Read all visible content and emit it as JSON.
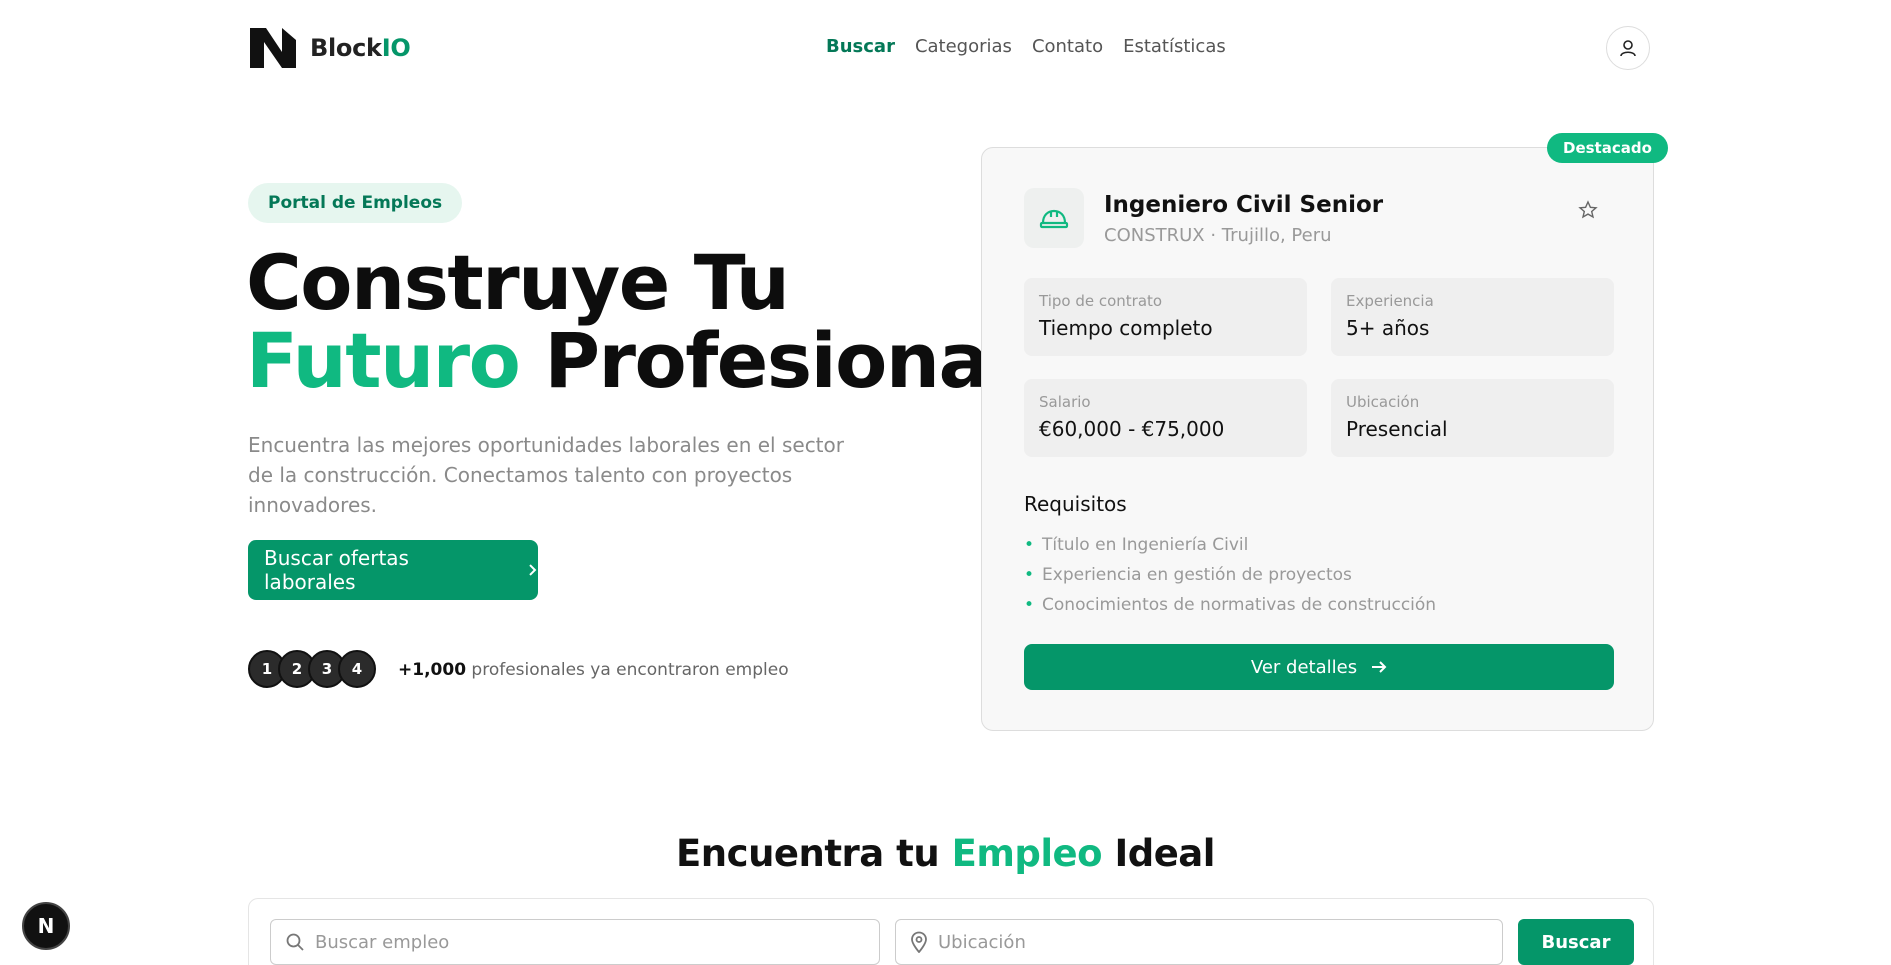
{
  "header": {
    "brand_prefix": "Block",
    "brand_suffix": "IO",
    "nav": [
      {
        "label": "Buscar",
        "active": true
      },
      {
        "label": "Categorias",
        "active": false
      },
      {
        "label": "Contato",
        "active": false
      },
      {
        "label": "Estatísticas",
        "active": false
      }
    ],
    "user_icon": "user-icon"
  },
  "hero": {
    "badge": "Portal de Empleos",
    "title_line1": "Construye Tu",
    "title_green": "Futuro",
    "title_rest": " Profesional",
    "description": "Encuentra las mejores oportunidades laborales en el sector de la construcción. Conectamos talento con proyectos innovadores.",
    "cta_label": "Buscar ofertas laborales",
    "avatars": [
      "1",
      "2",
      "3",
      "4"
    ],
    "pros_count": "+1,000",
    "pros_text": " profesionales ya encontraron empleo"
  },
  "job_card": {
    "featured_badge": "Destacado",
    "title": "Ingeniero Civil Senior",
    "subtitle": "CONSTRUX · Trujillo, Peru",
    "info": [
      {
        "label": "Tipo de contrato",
        "value": "Tiempo completo"
      },
      {
        "label": "Experiencia",
        "value": "5+ años"
      },
      {
        "label": "Salario",
        "value": "€60,000 - €75,000"
      },
      {
        "label": "Ubicación",
        "value": "Presencial"
      }
    ],
    "requirements_title": "Requisitos",
    "requirements": [
      "Título en Ingeniería Civil",
      "Experiencia en gestión de proyectos",
      "Conocimientos de normativas de construcción"
    ],
    "details_button": "Ver detalles"
  },
  "search": {
    "title_pre": "Encuentra tu ",
    "title_green": "Empleo",
    "title_post": " Ideal",
    "job_placeholder": "Buscar empleo",
    "location_placeholder": "Ubicación",
    "button": "Buscar"
  },
  "dev_badge": "N",
  "colors": {
    "accent": "#059669",
    "accent_light": "#10b981",
    "badge_bg": "#e6f6ef"
  }
}
